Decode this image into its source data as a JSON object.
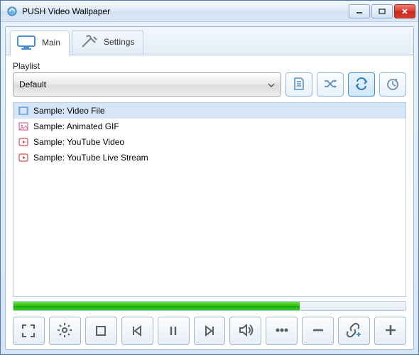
{
  "window": {
    "title": "PUSH Video Wallpaper"
  },
  "tabs": {
    "main": "Main",
    "settings": "Settings"
  },
  "playlist": {
    "label": "Playlist",
    "selected": "Default"
  },
  "items": [
    {
      "type": "video",
      "label": "Sample: Video File"
    },
    {
      "type": "image",
      "label": "Sample: Animated GIF"
    },
    {
      "type": "youtube",
      "label": "Sample: YouTube Video"
    },
    {
      "type": "youtube",
      "label": "Sample: YouTube Live Stream"
    }
  ],
  "progress": {
    "percent": 73
  },
  "colors": {
    "accent": "#3d8fd6",
    "progress_green": "#2fbf15"
  }
}
